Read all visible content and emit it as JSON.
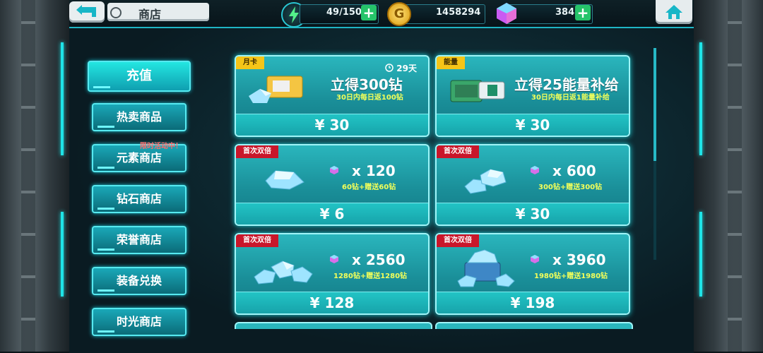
{
  "header": {
    "title": "商店",
    "energy": "49/150",
    "gold": "1458294",
    "gems": "384"
  },
  "sidebar": {
    "items": [
      {
        "label": "充值"
      },
      {
        "label": "热卖商品"
      },
      {
        "label": "元素商店"
      },
      {
        "label": "钻石商店"
      },
      {
        "label": "荣誉商店"
      },
      {
        "label": "装备兑换"
      },
      {
        "label": "时光商店"
      }
    ],
    "limited_label": "限时活动中！"
  },
  "cards": [
    {
      "tag": "月卡",
      "title": "立得300钻",
      "subtitle": "30日内每日返100钻",
      "price": "¥ 30",
      "timer_days": "29",
      "timer_unit": "天"
    },
    {
      "tag": "能量",
      "title": "立得25能量补给",
      "subtitle": "30日内每日返1能量补给",
      "price": "¥ 30"
    },
    {
      "tag": "首次双倍",
      "amount": "x 120",
      "subtitle": "60钻+赠送60钻",
      "price": "¥ 6"
    },
    {
      "tag": "首次双倍",
      "amount": "x 600",
      "subtitle": "300钻+赠送300钻",
      "price": "¥ 30"
    },
    {
      "tag": "首次双倍",
      "amount": "x 2560",
      "subtitle": "1280钻+赠送1280钻",
      "price": "¥ 128"
    },
    {
      "tag": "首次双倍",
      "amount": "x 3960",
      "subtitle": "1980钻+赠送1980钻",
      "price": "¥ 198"
    }
  ],
  "colors": {
    "accent": "#1fe3e6",
    "plus": "#26c46a",
    "tag_red": "#c9162a",
    "tag_yellow": "#f5c518"
  },
  "icons": [
    "back-arrow-icon",
    "no-sign-icon",
    "energy-bolt-icon",
    "gold-coin-icon",
    "gem-icon",
    "plus-icon",
    "home-icon",
    "clock-icon"
  ]
}
